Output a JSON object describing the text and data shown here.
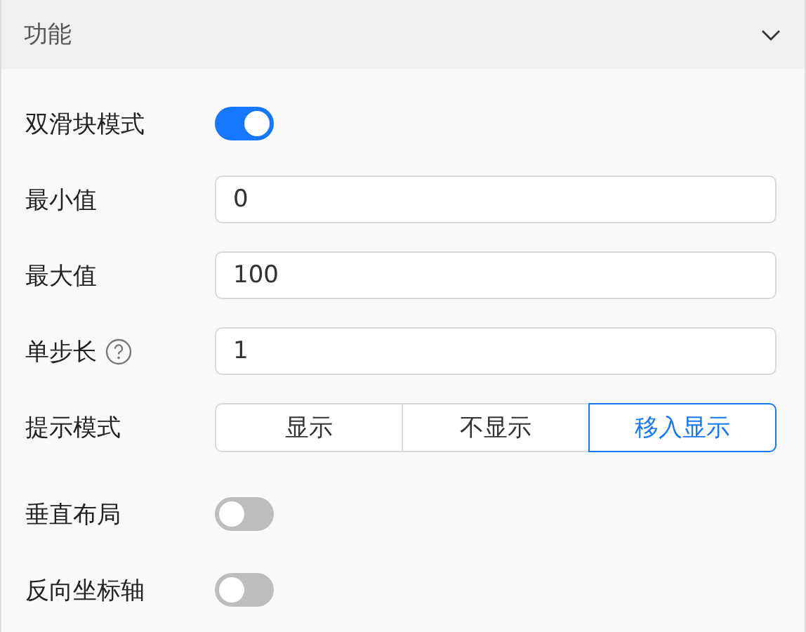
{
  "panel": {
    "title": "功能",
    "expanded": true
  },
  "rows": [
    {
      "kind": "toggle",
      "label": "双滑块模式",
      "on": true
    },
    {
      "kind": "input",
      "label": "最小值",
      "value": "0"
    },
    {
      "kind": "input",
      "label": "最大值",
      "value": "100"
    },
    {
      "kind": "input",
      "label": "单步长",
      "value": "1",
      "help": true
    },
    {
      "kind": "segmented",
      "label": "提示模式",
      "options": [
        {
          "label": "显示",
          "selected": false
        },
        {
          "label": "不显示",
          "selected": false
        },
        {
          "label": "移入显示",
          "selected": true
        }
      ]
    },
    {
      "kind": "toggle",
      "label": "垂直布局",
      "on": false
    },
    {
      "kind": "toggle",
      "label": "反向坐标轴",
      "on": false
    }
  ]
}
